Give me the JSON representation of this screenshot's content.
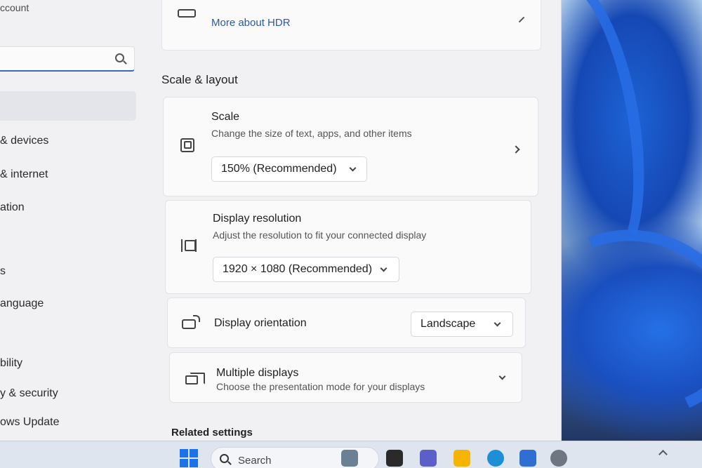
{
  "sidebar": {
    "account_label": "ccount",
    "search_placeholder": "",
    "items": [
      {
        "label": "& devices"
      },
      {
        "label": "& internet"
      },
      {
        "label": "ation"
      },
      {
        "label": "s"
      },
      {
        "label": "anguage"
      },
      {
        "label": "bility"
      },
      {
        "label": "y & security"
      },
      {
        "label": "ows Update"
      }
    ]
  },
  "hdr": {
    "link_label": "More about HDR"
  },
  "section": {
    "title": "Scale & layout"
  },
  "scale": {
    "title": "Scale",
    "subtitle": "Change the size of text, apps, and other items",
    "value": "150% (Recommended)"
  },
  "resolution": {
    "title": "Display resolution",
    "subtitle": "Adjust the resolution to fit your connected display",
    "value": "1920 × 1080 (Recommended)"
  },
  "orientation": {
    "title": "Display orientation",
    "value": "Landscape"
  },
  "multiple": {
    "title": "Multiple displays",
    "subtitle": "Choose the presentation mode for your displays"
  },
  "related": {
    "title": "Related settings"
  },
  "taskbar": {
    "search_label": "Search",
    "apps": [
      {
        "name": "widgets-icon",
        "color": "#6b7f95"
      },
      {
        "name": "task-view-icon",
        "color": "#2a2a2a"
      },
      {
        "name": "teams-icon",
        "color": "#5b5fc7"
      },
      {
        "name": "file-explorer-icon",
        "color": "#f4b400"
      },
      {
        "name": "edge-icon",
        "color": "#1e8fd6"
      },
      {
        "name": "store-icon",
        "color": "#2f6fd1"
      },
      {
        "name": "settings-icon",
        "color": "#6d7682"
      }
    ]
  },
  "colors": {
    "accent": "#2b5aa8",
    "window_bg": "#f1f1f4",
    "card_bg": "#fafafb"
  }
}
